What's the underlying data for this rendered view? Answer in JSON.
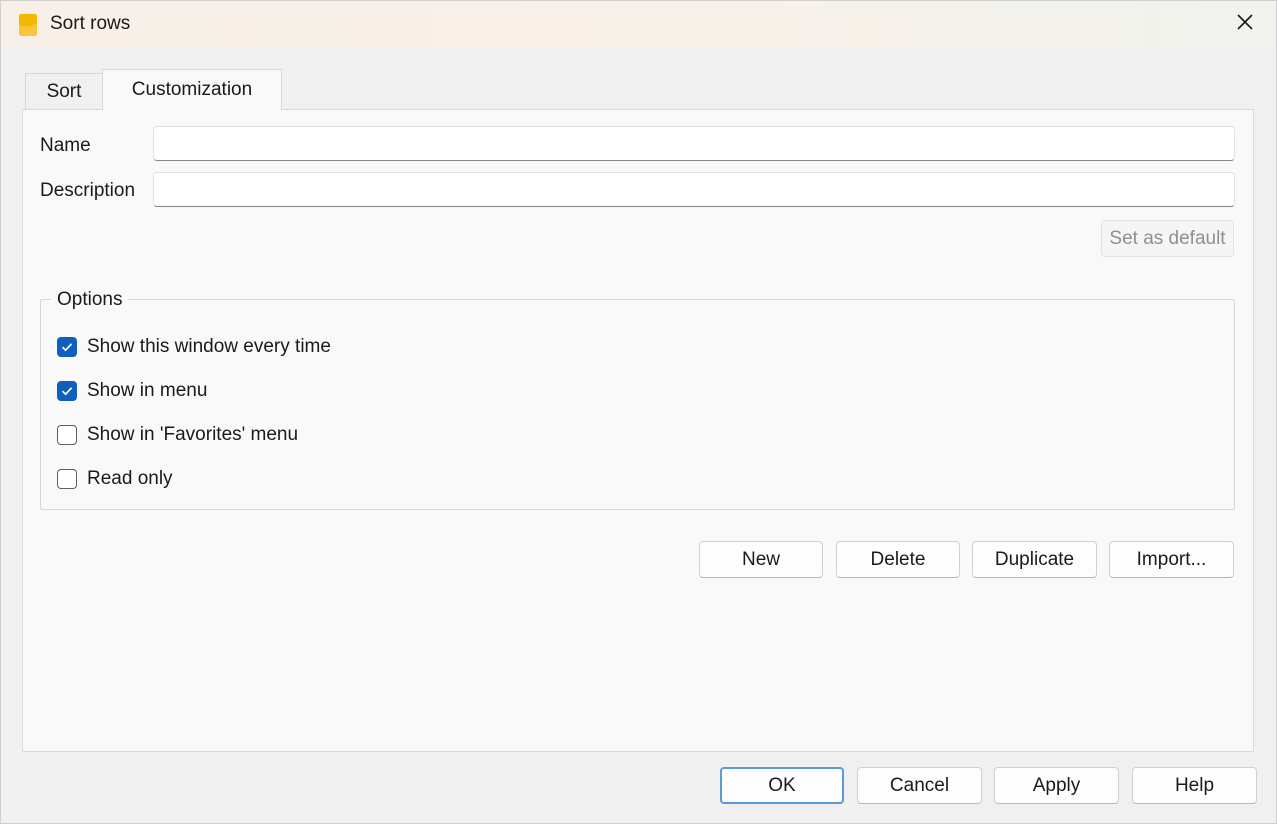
{
  "window": {
    "title": "Sort rows",
    "icon": "app-icon",
    "close_icon": "close-icon"
  },
  "tabs": [
    {
      "label": "Sort",
      "active": false
    },
    {
      "label": "Customization",
      "active": true
    }
  ],
  "form": {
    "name_label": "Name",
    "name_value": "",
    "description_label": "Description",
    "description_value": "",
    "set_default_label": "Set as default"
  },
  "options": {
    "title": "Options",
    "items": [
      {
        "label": "Show this window every time",
        "checked": true
      },
      {
        "label": "Show in menu",
        "checked": true
      },
      {
        "label": "Show in 'Favorites' menu",
        "checked": false
      },
      {
        "label": "Read only",
        "checked": false
      }
    ]
  },
  "actions": {
    "new_label": "New",
    "delete_label": "Delete",
    "duplicate_label": "Duplicate",
    "import_label": "Import..."
  },
  "footer": {
    "ok_label": "OK",
    "cancel_label": "Cancel",
    "apply_label": "Apply",
    "help_label": "Help"
  },
  "colors": {
    "accent": "#0f5fbf",
    "app_icon": "#f5b800"
  }
}
